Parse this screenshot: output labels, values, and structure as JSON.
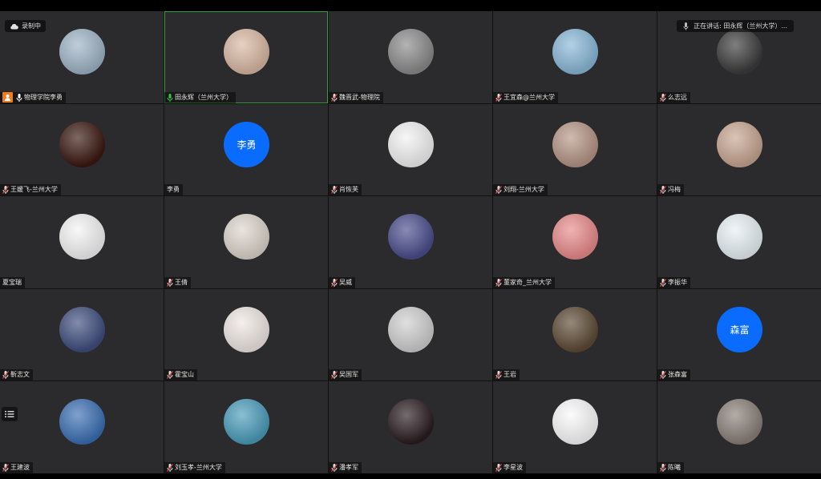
{
  "recording": {
    "label": "录制中"
  },
  "speaking": {
    "label": "正在讲话: 田永辉（兰州大学）..."
  },
  "colors": {
    "tile_bg": "#2b2b2d",
    "speaking_border": "#2ea043",
    "host_badge": "#f07c1b",
    "letter_avatar": "#0a6cff"
  },
  "participants": [
    {
      "name": "物理学院李勇",
      "host": true,
      "mic": "on",
      "avatar": "lake-mist-photo",
      "bg": "#9fb4c6"
    },
    {
      "name": "田永辉（兰州大学）",
      "speaking": true,
      "mic": "active",
      "avatar": "mother-child-photo",
      "bg": "#d9b8a2"
    },
    {
      "name": "魏晋武-物理院",
      "mic": "muted",
      "avatar": "fan-photo",
      "bg": "#8a8a8a"
    },
    {
      "name": "王宜森@兰州大学",
      "mic": "muted",
      "avatar": "baby-photo",
      "bg": "#89b8d8"
    },
    {
      "name": "么志远",
      "mic": "muted",
      "avatar": "man-glasses-photo",
      "bg": "#3b3b3b"
    },
    {
      "name": "王媛飞-兰州大学",
      "mic": "muted",
      "avatar": "sunset-photo",
      "bg": "#3a1810"
    },
    {
      "name": "李勇",
      "mic": "none",
      "avatar_text": "李勇",
      "bg": "#0a6cff"
    },
    {
      "name": "肖恢芙",
      "mic": "muted",
      "avatar": "cartoon-doodle",
      "bg": "#f2f2f2"
    },
    {
      "name": "刘翔-兰州大学",
      "mic": "muted",
      "avatar": "window-photo",
      "bg": "#b59585"
    },
    {
      "name": "冯梅",
      "mic": "muted",
      "avatar": "woman-photo",
      "bg": "#c7a591"
    },
    {
      "name": "夏宝瑞",
      "mic": "none",
      "avatar": "tree-drawing",
      "bg": "#f4f4f4"
    },
    {
      "name": "王倩",
      "mic": "muted",
      "avatar": "girl-back-photo",
      "bg": "#ddd5cc"
    },
    {
      "name": "吴威",
      "mic": "muted",
      "avatar": "homer-cartoon",
      "bg": "#4a4d8c"
    },
    {
      "name": "董家奇_兰州大学",
      "mic": "muted",
      "avatar": "cartoon-bear",
      "bg": "#e98a8a"
    },
    {
      "name": "李振华",
      "mic": "muted",
      "avatar": "tree-illustration",
      "bg": "#e8f1f4"
    },
    {
      "name": "靳志文",
      "mic": "muted",
      "avatar": "cartoon-glasses-boy",
      "bg": "#3f4d7e"
    },
    {
      "name": "霍宝山",
      "mic": "muted",
      "avatar": "couple-illustration",
      "bg": "#efe7e3"
    },
    {
      "name": "吴国军",
      "mic": "muted",
      "avatar": "sketch-man",
      "bg": "#cfcfcf"
    },
    {
      "name": "王岩",
      "mic": "muted",
      "avatar": "magnolia-photo",
      "bg": "#5d4a34"
    },
    {
      "name": "张森富",
      "mic": "muted",
      "avatar_text": "森富",
      "bg": "#0a6cff"
    },
    {
      "name": "王建波",
      "mic": "muted",
      "avatar": "lake-sky-photo",
      "bg": "#3b6fb3"
    },
    {
      "name": "刘玉孝-兰州大学",
      "mic": "muted",
      "avatar": "coast-photo",
      "bg": "#4a9cba"
    },
    {
      "name": "潘孝军",
      "mic": "muted",
      "avatar": "child-night-photo",
      "bg": "#2a1c20"
    },
    {
      "name": "李星波",
      "mic": "muted",
      "avatar": "hand-sketch",
      "bg": "#fafafa"
    },
    {
      "name": "陈曦",
      "mic": "muted",
      "avatar": "room-photo",
      "bg": "#8a7f78"
    }
  ]
}
